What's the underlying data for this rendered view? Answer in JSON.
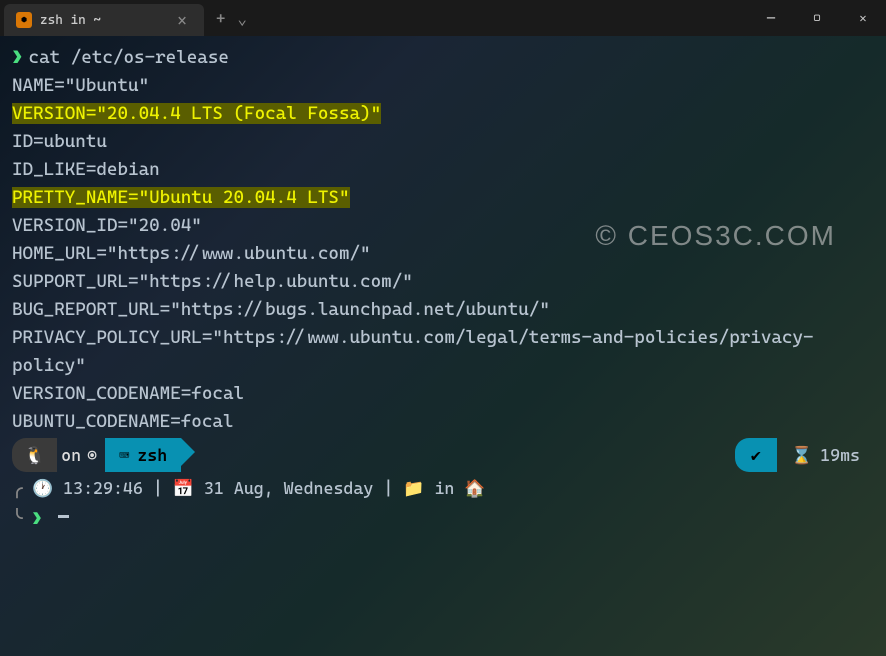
{
  "titlebar": {
    "tab_title": "zsh in ~",
    "tab_icon_glyph": "⬢"
  },
  "terminal": {
    "prompt": "❯",
    "command": "cat /etc/os-release",
    "output": [
      {
        "text": "NAME=\"Ubuntu\"",
        "highlight": false
      },
      {
        "text": "VERSION=\"20.04.4 LTS (Focal Fossa)\"",
        "highlight": true
      },
      {
        "text": "ID=ubuntu",
        "highlight": false
      },
      {
        "text": "ID_LIKE=debian",
        "highlight": false
      },
      {
        "text": "PRETTY_NAME=\"Ubuntu 20.04.4 LTS\"",
        "highlight": true
      },
      {
        "text": "VERSION_ID=\"20.04\"",
        "highlight": false
      },
      {
        "text": "HOME_URL=\"https://www.ubuntu.com/\"",
        "highlight": false
      },
      {
        "text": "SUPPORT_URL=\"https://help.ubuntu.com/\"",
        "highlight": false
      },
      {
        "text": "BUG_REPORT_URL=\"https://bugs.launchpad.net/ubuntu/\"",
        "highlight": false
      },
      {
        "text": "PRIVACY_POLICY_URL=\"https://www.ubuntu.com/legal/terms-and-policies/privacy-policy\"",
        "highlight": false
      },
      {
        "text": "VERSION_CODENAME=focal",
        "highlight": false
      },
      {
        "text": "UBUNTU_CODENAME=focal",
        "highlight": false
      }
    ]
  },
  "statusbar": {
    "tux": "🐧",
    "on": "on",
    "circle": "◉",
    "shell_icon": "⌨",
    "shell": "zsh",
    "check": "✔",
    "hourglass": "⌛",
    "duration": "19ms"
  },
  "infoline": {
    "clock_icon": "🕐",
    "time": "13:29:46",
    "sep": "|",
    "cal_icon": "📅",
    "date": "31 Aug, Wednesday",
    "folder_icon": "📁",
    "in": "in",
    "home_icon": "🏠"
  },
  "prompt2": "❯",
  "watermark": "© CEOS3C.COM"
}
